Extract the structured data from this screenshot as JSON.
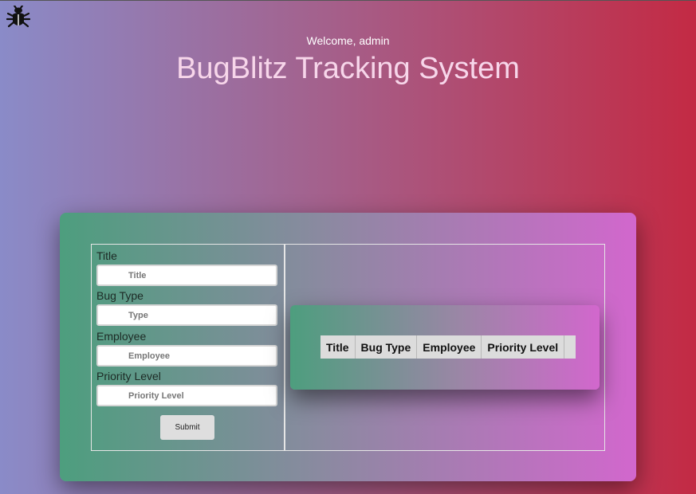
{
  "header": {
    "welcome": "Welcome, admin",
    "title": "BugBlitz Tracking System",
    "logo_icon": "bug-icon"
  },
  "form": {
    "fields": [
      {
        "label": "Title",
        "placeholder": "Title"
      },
      {
        "label": "Bug Type",
        "placeholder": "Type"
      },
      {
        "label": "Employee",
        "placeholder": "Employee"
      },
      {
        "label": "Priority Level",
        "placeholder": "Priority Level"
      }
    ],
    "submit_label": "Submit"
  },
  "table": {
    "columns": [
      "Title",
      "Bug Type",
      "Employee",
      "Priority Level"
    ]
  },
  "colors": {
    "background_left": "#8a8bc8",
    "background_right": "#c32a44",
    "card_left": "#4d9e7e",
    "card_right": "#d267cd"
  }
}
